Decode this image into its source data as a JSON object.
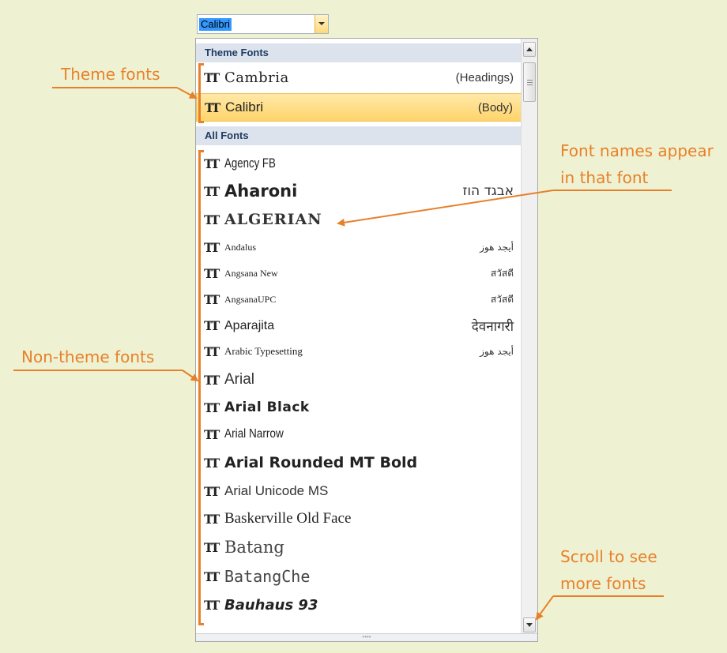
{
  "combo": {
    "value": "Calibri"
  },
  "theme_header": "Theme Fonts",
  "theme_fonts": [
    {
      "name": "Cambria",
      "tag": "(Headings)"
    },
    {
      "name": "Calibri",
      "tag": "(Body)"
    }
  ],
  "all_header": "All Fonts",
  "fonts": [
    {
      "name": "Agency FB",
      "sample": ""
    },
    {
      "name": "Aharoni",
      "sample": "אבגד הוז"
    },
    {
      "name": "ALGERIAN",
      "sample": ""
    },
    {
      "name": "Andalus",
      "sample": "أيجد هوز"
    },
    {
      "name": "Angsana New",
      "sample": "สวัสดี"
    },
    {
      "name": "AngsanaUPC",
      "sample": "สวัสดี"
    },
    {
      "name": "Aparajita",
      "sample": "देवनागरी"
    },
    {
      "name": "Arabic Typesetting",
      "sample": "أيجد هوز"
    },
    {
      "name": "Arial",
      "sample": ""
    },
    {
      "name": "Arial Black",
      "sample": ""
    },
    {
      "name": "Arial Narrow",
      "sample": ""
    },
    {
      "name": "Arial Rounded MT Bold",
      "sample": ""
    },
    {
      "name": "Arial Unicode MS",
      "sample": ""
    },
    {
      "name": "Baskerville Old Face",
      "sample": ""
    },
    {
      "name": "Batang",
      "sample": ""
    },
    {
      "name": "BatangChe",
      "sample": ""
    },
    {
      "name": "Bauhaus 93",
      "sample": ""
    }
  ],
  "annotations": {
    "theme_fonts": "Theme fonts",
    "font_names_line1": "Font names appear",
    "font_names_line2": "in that font",
    "non_theme": "Non-theme fonts",
    "scroll_line1": "Scroll to see",
    "scroll_line2": "more fonts"
  },
  "grip_dots": "••••",
  "colors": {
    "annotation": "#e8802a",
    "highlight": "#ffd46b",
    "header": "#dde3ec",
    "background": "#eef2d2"
  }
}
